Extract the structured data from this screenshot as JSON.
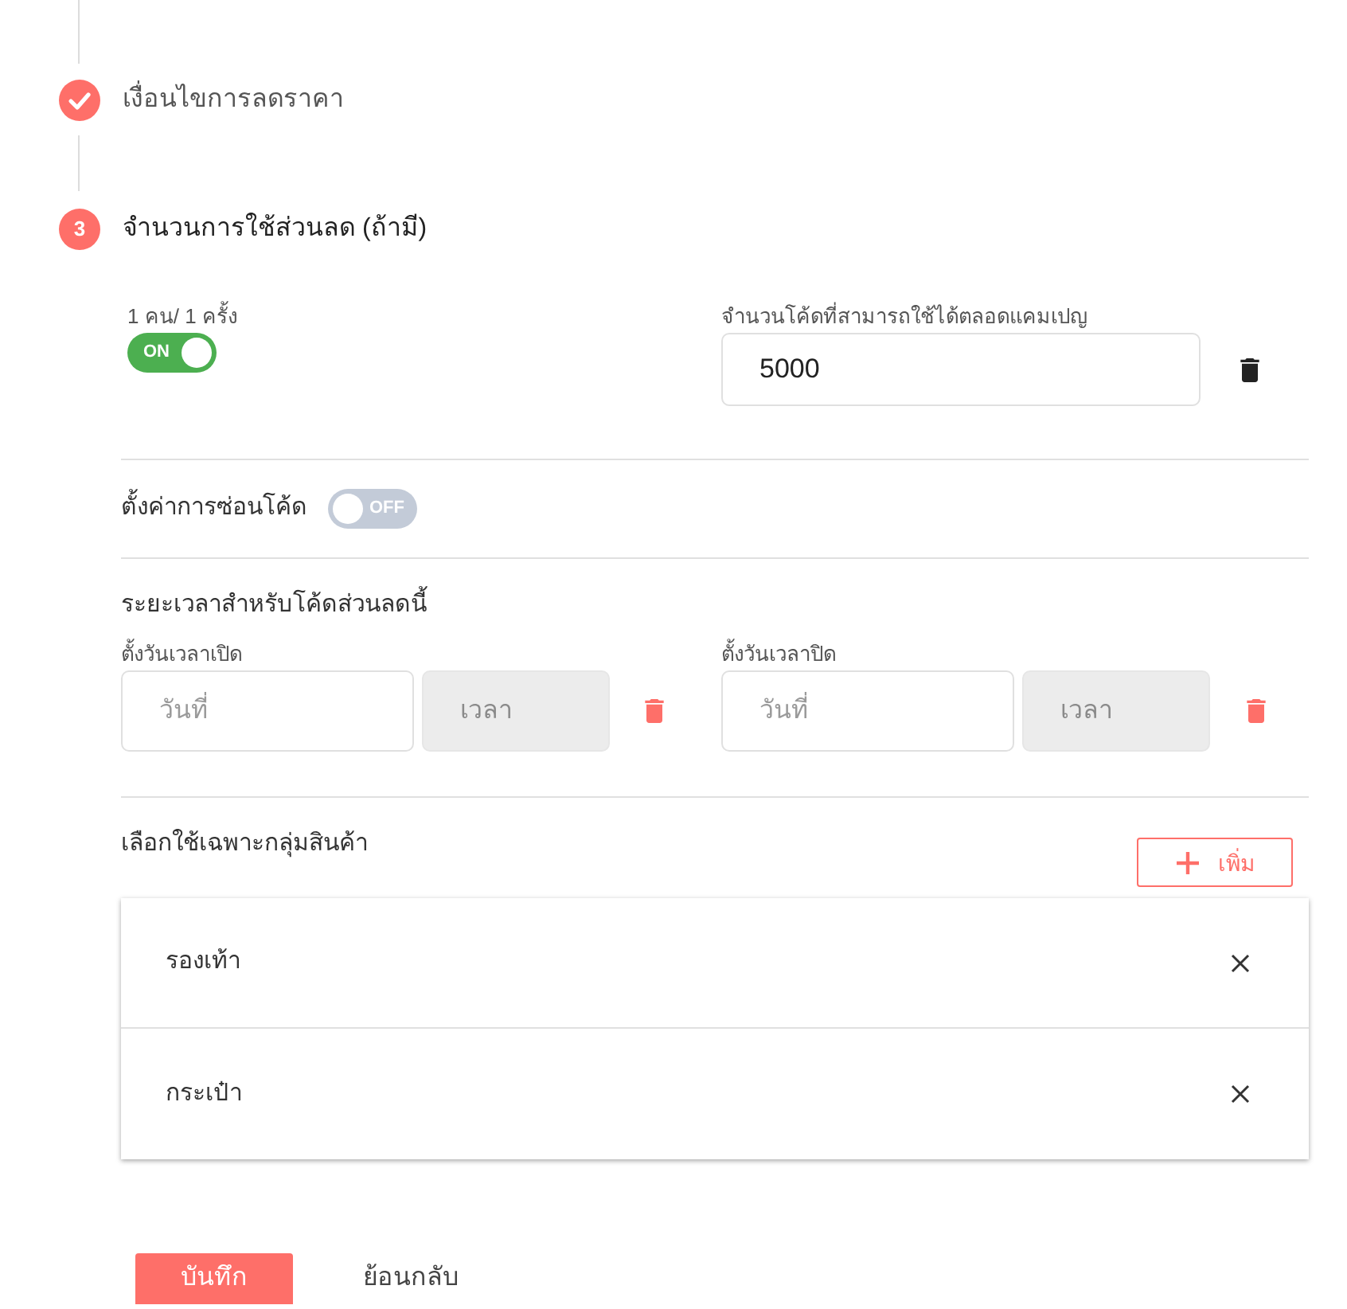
{
  "steps": [
    {
      "kind": "done",
      "label": "เงื่อนไขการลดราคา"
    },
    {
      "kind": "current",
      "number": "3",
      "label": "จำนวนการใช้ส่วนลด (ถ้ามี)"
    }
  ],
  "usage": {
    "per_user": {
      "label": "1 คน/ 1 ครั้ง",
      "switch_text": "ON",
      "on": true
    },
    "total_codes": {
      "label": "จำนวนโค้ดที่สามารถใช้ได้ตลอดแคมเปญ",
      "value": "5000"
    }
  },
  "hide_code": {
    "label": "ตั้งค่าการซ่อนโค้ด",
    "switch_text": "OFF",
    "on": false
  },
  "period": {
    "title": "ระยะเวลาสำหรับโค้ดส่วนลดนี้",
    "ranges": [
      {
        "label": "ตั้งวันเวลาเปิด",
        "date": {
          "placeholder": "วันที่"
        },
        "time": {
          "placeholder": "เวลา",
          "disabled": true
        }
      },
      {
        "label": "ตั้งวันเวลาปิด",
        "date": {
          "placeholder": "วันที่"
        },
        "time": {
          "placeholder": "เวลา",
          "disabled": true
        }
      }
    ]
  },
  "product_groups": {
    "title": "เลือกใช้เฉพาะกลุ่มสินค้า",
    "add_button": "เพิ่ม",
    "items": [
      {
        "label": "รองเท้า"
      },
      {
        "label": "กระเป๋า"
      }
    ]
  },
  "actions": [
    {
      "kind": "primary",
      "label": "บันทึก"
    },
    {
      "kind": "secondary",
      "label": "ย้อนกลับ"
    }
  ]
}
